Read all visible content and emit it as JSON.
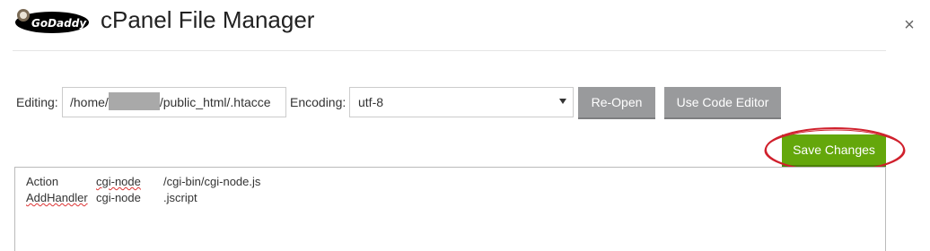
{
  "header": {
    "logo_text": "GoDaddy",
    "title": "cPanel File Manager",
    "close_symbol": "×"
  },
  "toolbar": {
    "editing_label": "Editing:",
    "path_prefix": "/home/",
    "path_suffix": "/public_html/.htacce",
    "encoding_label": "Encoding:",
    "encoding_value": "utf-8",
    "reopen_label": "Re-Open",
    "code_editor_label": "Use Code Editor",
    "save_label": "Save Changes"
  },
  "editor": {
    "lines": [
      {
        "col1": "Action",
        "col2": "cgi-node",
        "col3": "/cgi-bin/cgi-node.js"
      },
      {
        "col1": "AddHandler",
        "col2": "cgi-node",
        "col3": ".jscript"
      }
    ]
  },
  "colors": {
    "save_button": "#64a70b",
    "gray_button": "#999a9c",
    "highlight_ellipse": "#d0212d"
  },
  "icons": {
    "close": "close-icon",
    "dropdown": "chevron-down-icon",
    "logo": "godaddy-logo"
  }
}
